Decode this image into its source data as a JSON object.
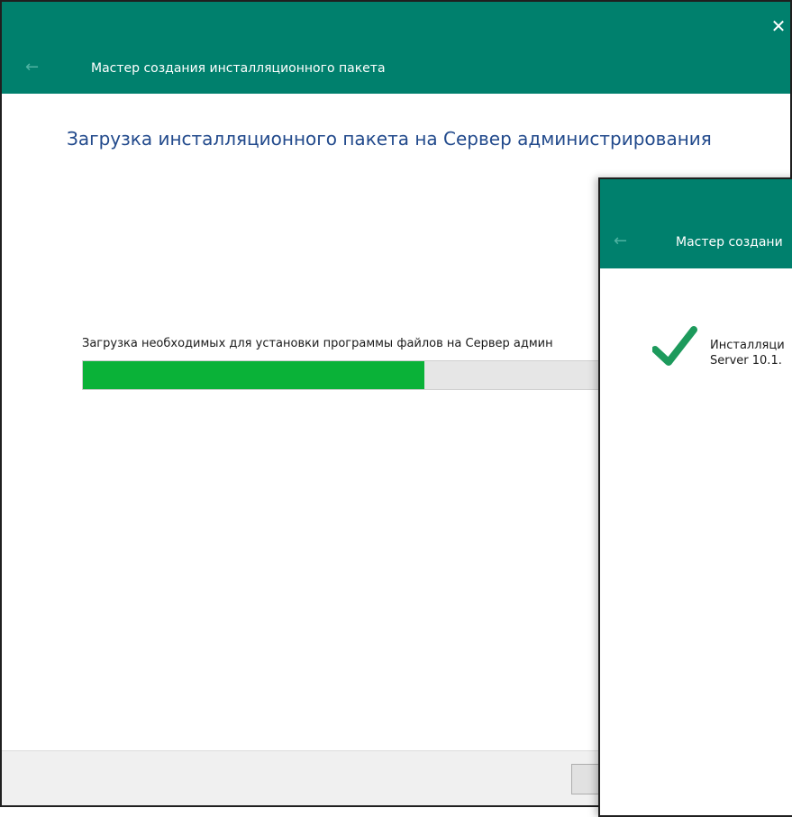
{
  "main_window": {
    "title": "Мастер создания инсталляционного пакета",
    "close_glyph": "✕",
    "back_glyph": "←",
    "heading": "Загрузка инсталляционного пакета на Сервер администрирования",
    "progress": {
      "label": "Загрузка необходимых для установки программы файлов на Сервер админ",
      "value_fraction": 0.5
    }
  },
  "result_window": {
    "title": "Мастер создани",
    "back_glyph": "←",
    "status_icon": "checkmark-icon",
    "message_line1": "Инсталляци",
    "message_line2": "Server 10.1."
  },
  "colors": {
    "titlebar": "#00806d",
    "heading": "#224a8c",
    "progress_fill": "#0ab238",
    "checkmark": "#1d9a5c"
  }
}
